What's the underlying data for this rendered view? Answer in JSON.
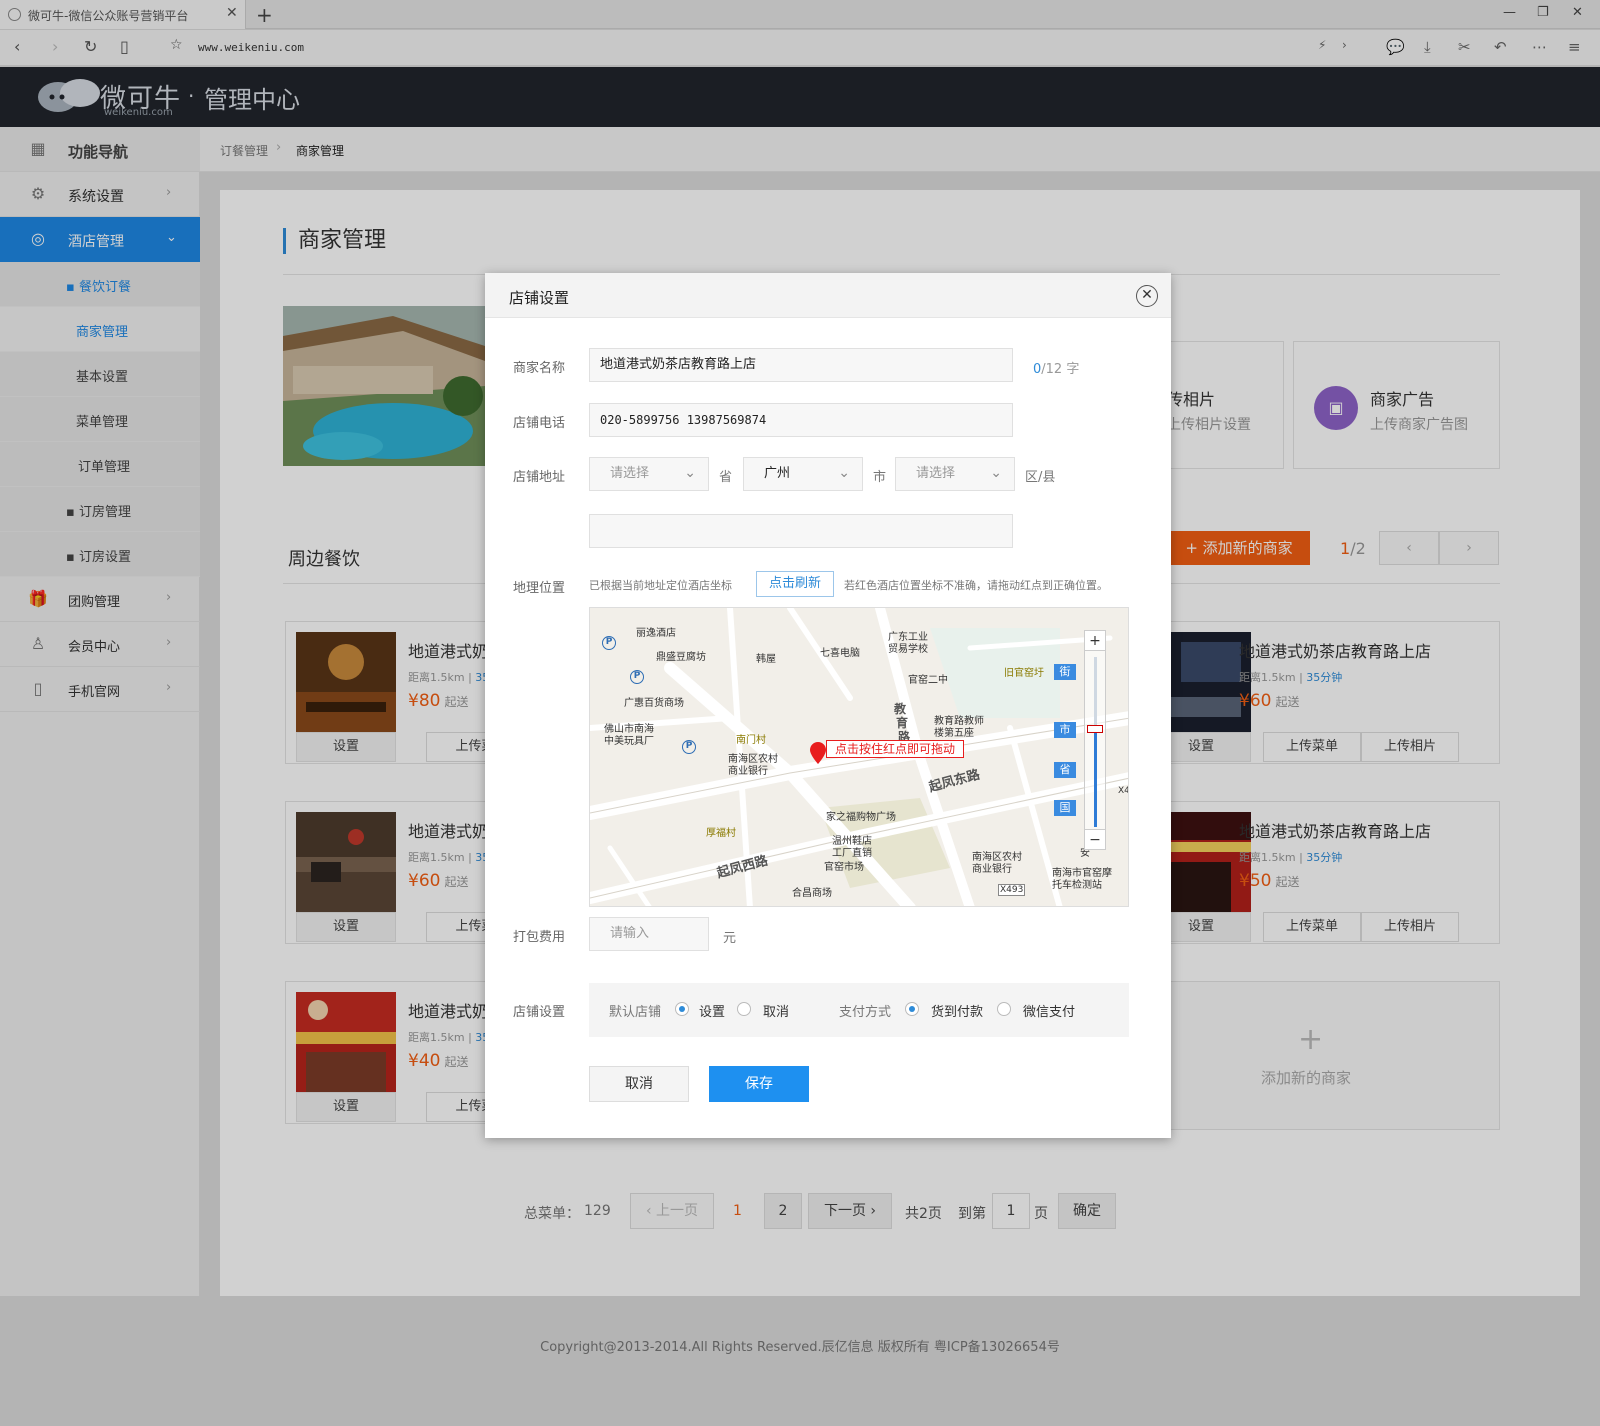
{
  "browser": {
    "tab_title": "微可牛-微信公众账号营销平台",
    "url": "www.weikeniu.com"
  },
  "header": {
    "logo_main": "微可牛",
    "logo_sub": "weikeniu.com",
    "logo_dot": "·",
    "title": "管理中心"
  },
  "sidebar": {
    "nav_title": "功能导航",
    "items": [
      {
        "label": "系统设置"
      },
      {
        "label": "酒店管理"
      },
      {
        "label": "▪ 餐饮订餐"
      },
      {
        "label": "商家管理"
      },
      {
        "label": "基本设置"
      },
      {
        "label": "菜单管理"
      },
      {
        "label": "订单管理"
      },
      {
        "label": "▪ 订房管理"
      },
      {
        "label": "▪ 订房设置"
      },
      {
        "label": "团购管理"
      },
      {
        "label": "会员中心"
      },
      {
        "label": "手机官网"
      }
    ]
  },
  "breadcrumb": {
    "parent": "订餐管理",
    "current": "商家管理"
  },
  "main": {
    "page_title": "商家管理",
    "features": [
      {
        "title": "传相片",
        "desc": "上传相片设置"
      },
      {
        "title": "商家广告",
        "desc": "上传商家广告图"
      }
    ],
    "section_title": "周边餐饮",
    "add_button": "+ 添加新的商家",
    "page_current": "1",
    "page_total": "/2",
    "merchants": [
      {
        "name": "地道港式奶",
        "dist": "距离1.5km | ",
        "time": "35",
        "price": "¥80",
        "unit": "起送",
        "set": "设置",
        "btn1": "上传菜",
        "btn2": ""
      },
      {
        "name": "地道港式奶",
        "dist": "距离1.5km | ",
        "time": "35",
        "price": "¥60",
        "unit": "起送",
        "set": "设置",
        "btn1": "上传菜",
        "btn2": ""
      },
      {
        "name": "地道港式奶",
        "dist": "距离1.5km | ",
        "time": "35",
        "price": "¥40",
        "unit": "起送",
        "set": "设置",
        "btn1": "上传菜",
        "btn2": ""
      },
      {
        "name": "地道港式奶茶店教育路上店",
        "dist": "距离1.5km | ",
        "time": "35分钟",
        "price": "¥60",
        "unit": "起送",
        "set": "设置",
        "btn1": "上传菜单",
        "btn2": "上传相片"
      },
      {
        "name": "地道港式奶茶店教育路上店",
        "dist": "距离1.5km | ",
        "time": "35分钟",
        "price": "¥50",
        "unit": "起送",
        "set": "设置",
        "btn1": "上传菜单",
        "btn2": "上传相片"
      }
    ],
    "add_card": {
      "plus": "+",
      "label": "添加新的商家"
    },
    "pagination": {
      "total_label": "总菜单：",
      "total": "129",
      "prev": "上一页",
      "p1": "1",
      "p2": "2",
      "next": "下一页",
      "pages": "共2页",
      "goto": "到第",
      "goto_value": "1",
      "page_unit": "页",
      "confirm": "确定"
    }
  },
  "footer": {
    "copyright": "Copyright@2013-2014.All Rights Reserved.辰亿信息 版权所有 粤ICP备13026654号"
  },
  "dialog": {
    "title": "店铺设置",
    "name_label": "商家名称",
    "name_value": "地道港式奶茶店教育路上店",
    "name_count": "0",
    "name_count_suffix": "/12 字",
    "phone_label": "店铺电话",
    "phone_value": "020-5899756  13987569874",
    "addr_label": "店铺地址",
    "province_select": "请选择",
    "province_unit": "省",
    "city_select": "广州",
    "city_unit": "市",
    "district_select": "请选择",
    "district_unit": "区/县",
    "addr_detail": "",
    "geo_label": "地理位置",
    "geo_tip": "已根据当前地址定位酒店坐标",
    "refresh_button": "点击刷新",
    "geo_tip2": "若红色酒店位置坐标不准确，请拖动红点到正确位置。",
    "map": {
      "marker_tip": "点击按住红点即可拖动",
      "zoom_in": "+",
      "zoom_out": "−",
      "levels": [
        "街",
        "市",
        "省",
        "国"
      ],
      "labels": [
        "丽逸酒店",
        "鼎盛豆腐坊",
        "韩屋",
        "七喜电脑",
        "广东工业",
        "贸易学校",
        "官窑二中",
        "旧官窑圩",
        "广惠百货商场",
        "佛山市南海",
        "中美玩具厂",
        "南门村",
        "南海区农村",
        "商业银行",
        "教",
        "育",
        "路",
        "教育路教师",
        "楼第五座",
        "起凤东路",
        "家之福购物广场",
        "厚福村",
        "温州鞋店",
        "工厂直销",
        "起凤西路",
        "官窑市场",
        "南海区农村",
        "商业银行",
        "安",
        "南海市官窑摩",
        "托车检测站",
        "合昌商场",
        "X493",
        "X4"
      ]
    },
    "pack_label": "打包费用",
    "pack_placeholder": "请输入",
    "pack_unit": "元",
    "store_label": "店铺设置",
    "default_label": "默认店铺",
    "default_set": "设置",
    "default_cancel": "取消",
    "pay_label": "支付方式",
    "pay_cod": "货到付款",
    "pay_wechat": "微信支付",
    "cancel_button": "取消",
    "save_button": "保存"
  }
}
